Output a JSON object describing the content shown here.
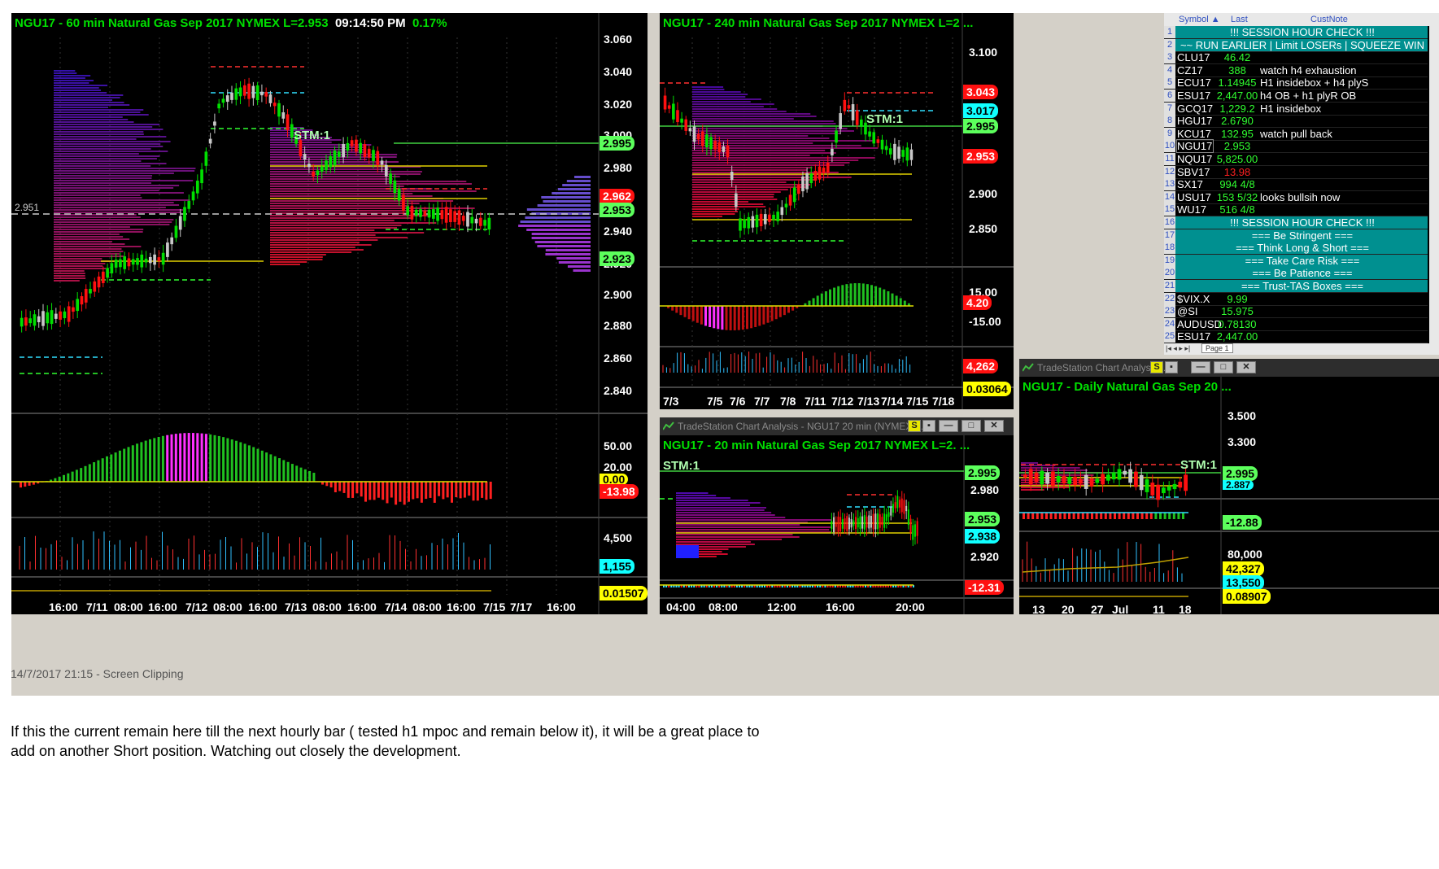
{
  "panel60": {
    "title": "NGU17 - 60 min  Natural Gas Sep 2017  NYMEX  L=2.953",
    "time": "09:14:50 PM",
    "change": "0.17%",
    "stm": "STM:1",
    "ref_label": "2.951",
    "y_ticks": [
      "3.060",
      "3.040",
      "3.020",
      "3.000",
      "2.980",
      "2.960",
      "2.940",
      "2.920",
      "2.900",
      "2.880",
      "2.860",
      "2.840"
    ],
    "tags": [
      "2.995",
      "2.962",
      "2.953",
      "2.923"
    ],
    "ind1_ticks": [
      "50.00",
      "20.00",
      "0.00"
    ],
    "ind1_tag": "-13.98",
    "vol_tick": "4,500",
    "vol_tag": "1,155",
    "ind3_tag": "0.01507",
    "x_ticks": [
      "16:00",
      "7/11",
      "08:00",
      "16:00",
      "7/12",
      "08:00",
      "16:00",
      "7/13",
      "08:00",
      "16:00",
      "7/14",
      "08:00",
      "16:00",
      "7/15",
      "7/17",
      "16:00"
    ]
  },
  "panel240": {
    "title": "NGU17 - 240 min  Natural Gas Sep 2017  NYMEX  L=2 ...",
    "stm": "STM:1",
    "y_ticks": [
      "3.100",
      "3.050",
      "2.900",
      "2.850"
    ],
    "tags": [
      "3.043",
      "3.017",
      "2.995",
      "2.953"
    ],
    "ind1_ticks": [
      "15.00",
      "-15.00"
    ],
    "ind1_tag": "4.20",
    "vol_tag": "4,262",
    "ind3_tag": "0.03064",
    "x_ticks": [
      "7/3",
      "7/5",
      "7/6",
      "7/7",
      "7/8",
      "7/11",
      "7/12",
      "7/13",
      "7/14",
      "7/15",
      "7/18"
    ]
  },
  "panel20": {
    "window_title": "TradeStation Chart Analysis - NGU17 20 min (NYMEX) ...",
    "title": "NGU17 - 20 min  Natural Gas Sep 2017  NYMEX  L=2. ...",
    "stm": "STM:1",
    "y_ticks": [
      "2.980",
      "2.960",
      "2.920"
    ],
    "tags": [
      "2.995",
      "2.953",
      "2.938"
    ],
    "ind1_tag": "-12.31",
    "x_ticks": [
      "04:00",
      "08:00",
      "12:00",
      "16:00",
      "20:00"
    ]
  },
  "panelDaily": {
    "window_title": "TradeStation Chart Analysis ...",
    "title": "NGU17 - Daily  Natural Gas Sep 20 ...",
    "stm": "STM:1",
    "y_ticks": [
      "3.500",
      "3.300"
    ],
    "tags": [
      "2.995",
      "2.887"
    ],
    "ind1_tag": "-12.88",
    "vol_tick": "80,000",
    "vol_tag1": "42,327",
    "vol_tag2": "13,550",
    "ind3_tag": "0.08907",
    "x_ticks": [
      "13",
      "20",
      "27",
      "Jul",
      "11",
      "18"
    ]
  },
  "window_buttons": {
    "s": "S",
    "min": "—",
    "max": "□",
    "close": "✕"
  },
  "grid": {
    "headers": {
      "symbol": "Symbol ▲",
      "last": "Last",
      "note": "CustNote"
    },
    "rows": [
      {
        "n": "1",
        "span": "!!!                SESSION HOUR CHECK                !!!",
        "bg": "#009090"
      },
      {
        "n": "2",
        "span": "~~ RUN EARLIER | Limit LOSERs | SQUEEZE WIN",
        "bg": "#009090"
      },
      {
        "n": "3",
        "sym": "CLU17",
        "last": "46.42",
        "lc": "#30ff30",
        "note": ""
      },
      {
        "n": "4",
        "sym": "CZ17",
        "last": "388",
        "lc": "#30ff30",
        "note": "watch h4 exhaustion"
      },
      {
        "n": "5",
        "sym": "ECU17",
        "last": "1.14945",
        "lc": "#30ff30",
        "note": "H1 insidebox + h4 plyS"
      },
      {
        "n": "6",
        "sym": "ESU17",
        "last": "2,447.00",
        "lc": "#30ff30",
        "note": "h4 OB + h1 plyR OB"
      },
      {
        "n": "7",
        "sym": "GCQ17",
        "last": "1,229.2",
        "lc": "#30ff30",
        "note": "H1 insidebox"
      },
      {
        "n": "8",
        "sym": "HGU17",
        "last": "2.6790",
        "lc": "#30ff30",
        "note": ""
      },
      {
        "n": "9",
        "sym": "KCU17",
        "last": "132.95",
        "lc": "#30ff30",
        "note": "watch pull back"
      },
      {
        "n": "10",
        "sym": "NGU17",
        "last": "2.953",
        "lc": "#30ff30",
        "note": ""
      },
      {
        "n": "11",
        "sym": "NQU17",
        "last": "5,825.00",
        "lc": "#30ff30",
        "note": ""
      },
      {
        "n": "12",
        "sym": "SBV17",
        "last": "13.98",
        "lc": "#ff2020",
        "note": ""
      },
      {
        "n": "13",
        "sym": "SX17",
        "last": "994  4/8",
        "lc": "#30ff30",
        "note": ""
      },
      {
        "n": "14",
        "sym": "USU17",
        "last": "153  5/32",
        "lc": "#30ff30",
        "note": "looks bullsih now"
      },
      {
        "n": "15",
        "sym": "WU17",
        "last": "516  4/8",
        "lc": "#30ff30",
        "note": ""
      },
      {
        "n": "16",
        "span": "!!!                SESSION HOUR CHECK                !!!",
        "bg": "#009090"
      },
      {
        "n": "17",
        "span": "===                    Be Stringent                    ===",
        "bg": "#009090"
      },
      {
        "n": "18",
        "span": "===               Think Long & Short               ===",
        "bg": "#009090"
      },
      {
        "n": "19",
        "span": "===                 Take Care Risk                 ===",
        "bg": "#009090"
      },
      {
        "n": "20",
        "span": "===                   Be  Patience                   ===",
        "bg": "#009090"
      },
      {
        "n": "21",
        "span": "===                  Trust-TAS Boxes                  ===",
        "bg": "#009090"
      },
      {
        "n": "22",
        "sym": "$VIX.X",
        "last": "9.99",
        "lc": "#30ff30",
        "note": ""
      },
      {
        "n": "23",
        "sym": "@SI",
        "last": "15.975",
        "lc": "#30ff30",
        "note": ""
      },
      {
        "n": "24",
        "sym": "AUDUSD",
        "last": "0.78130",
        "lc": "#30ff30",
        "note": ""
      },
      {
        "n": "25",
        "sym": "ESU17",
        "last": "2,447.00",
        "lc": "#30ff30",
        "note": ""
      }
    ],
    "page_tab": "Page 1"
  },
  "caption": {
    "stamp": "14/7/2017 21:15 - Screen Clipping",
    "note_line1": "If this the current remain here till the next hourly bar ( tested h1 mpoc and remain below it), it will be a great place to",
    "note_line2": "add on another Short position. Watching out closely the development."
  },
  "colors": {
    "up": "#00e000",
    "down": "#ff1010",
    "neutral": "#c8c8c8",
    "panel_bg": "#000000"
  }
}
